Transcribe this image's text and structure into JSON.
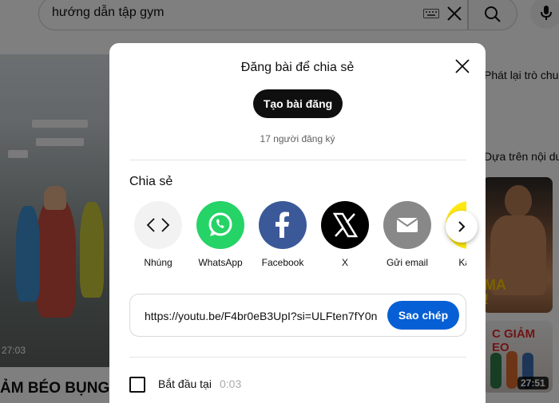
{
  "header": {
    "search_query": "hướng dẫn tập gym"
  },
  "video": {
    "duration": "27:03",
    "title": "ẢM BÉO BỤNG I"
  },
  "sidebar": {
    "chip1": "Phát lại trò chu",
    "chip2": "Dựa trên nội du",
    "thumb1_text": "MA\n!",
    "thumb2_text": "C GIẢM EO",
    "thumb2_duration": "27:51"
  },
  "dialog": {
    "post_title": "Đăng bài để chia sẻ",
    "create_post_label": "Tạo bài đăng",
    "subscribers": "17 người đăng ký",
    "share_heading": "Chia sẻ",
    "share_options": [
      {
        "label": "Nhúng",
        "icon": "embed-icon",
        "color": "#f2f2f2"
      },
      {
        "label": "WhatsApp",
        "icon": "whatsapp-icon",
        "color": "#25d366"
      },
      {
        "label": "Facebook",
        "icon": "facebook-icon",
        "color": "#3b5998"
      },
      {
        "label": "X",
        "icon": "x-icon",
        "color": "#000000"
      },
      {
        "label": "Gửi email",
        "icon": "email-icon",
        "color": "#888888"
      },
      {
        "label": "Kaka",
        "icon": "kakao-icon",
        "color": "#ffe812"
      }
    ],
    "link_url": "https://youtu.be/F4br0eB3UpI?si=ULFten7fY0n",
    "copy_label": "Sao chép",
    "start_at_label": "Bắt đầu tại",
    "start_at_time": "0:03"
  },
  "colors": {
    "accent_blue": "#065fd4",
    "dark_button": "#0f0f0f"
  }
}
